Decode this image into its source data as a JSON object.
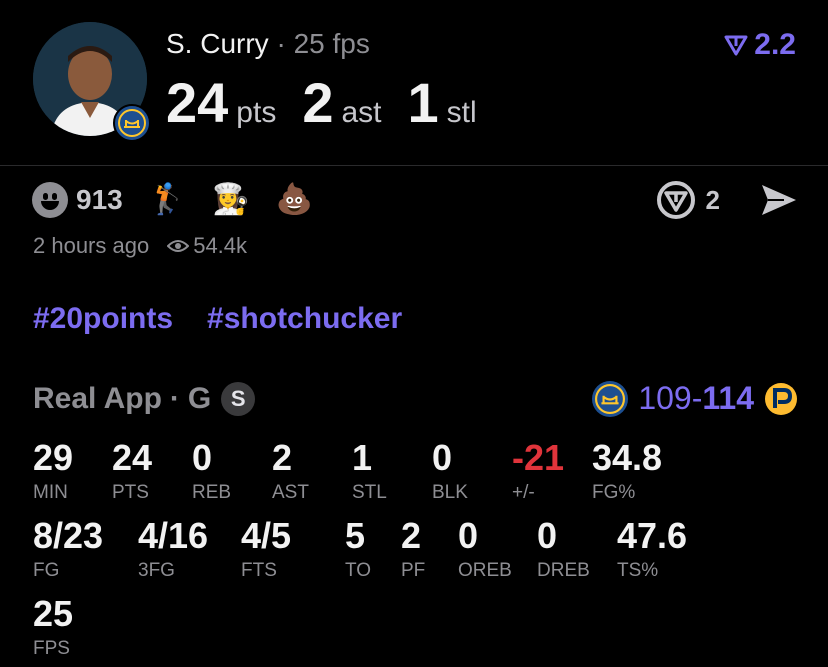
{
  "header": {
    "player_name": "S. Curry",
    "separator": "·",
    "fps_text": "25 fps",
    "points": "24",
    "points_unit": "pts",
    "assists": "2",
    "assists_unit": "ast",
    "steals": "1",
    "steals_unit": "stl",
    "rating": "2.2",
    "rating_icon": "real-logo-icon"
  },
  "reactions": {
    "count": "913",
    "emojis": [
      "🏌️",
      "👩‍🍳",
      "💩"
    ],
    "share_count": "2"
  },
  "meta": {
    "time_ago": "2 hours ago",
    "views": "54.4k"
  },
  "tags": [
    "#20points",
    "#shotchucker"
  ],
  "game": {
    "source": "Real App",
    "separator": "·",
    "position": "G",
    "badge": "S",
    "score_home": "109",
    "score_dash": "-",
    "score_away": "114"
  },
  "stats": [
    {
      "value": "29",
      "label": "MIN"
    },
    {
      "value": "24",
      "label": "PTS"
    },
    {
      "value": "0",
      "label": "REB"
    },
    {
      "value": "2",
      "label": "AST"
    },
    {
      "value": "1",
      "label": "STL"
    },
    {
      "value": "0",
      "label": "BLK"
    },
    {
      "value": "-21",
      "label": "+/-"
    },
    {
      "value": "34.8",
      "label": "FG%"
    },
    {
      "value": "8/23",
      "label": "FG"
    },
    {
      "value": "4/16",
      "label": "3FG"
    },
    {
      "value": "4/5",
      "label": "FTS"
    },
    {
      "value": "5",
      "label": "TO"
    },
    {
      "value": "2",
      "label": "PF"
    },
    {
      "value": "0",
      "label": "OREB"
    },
    {
      "value": "0",
      "label": "DREB"
    },
    {
      "value": "47.6",
      "label": "TS%"
    },
    {
      "value": "25",
      "label": "FPS"
    }
  ],
  "colors": {
    "accent": "#7c6cf0",
    "negative": "#e0343b",
    "muted": "#8e8e93",
    "background": "#000000"
  }
}
